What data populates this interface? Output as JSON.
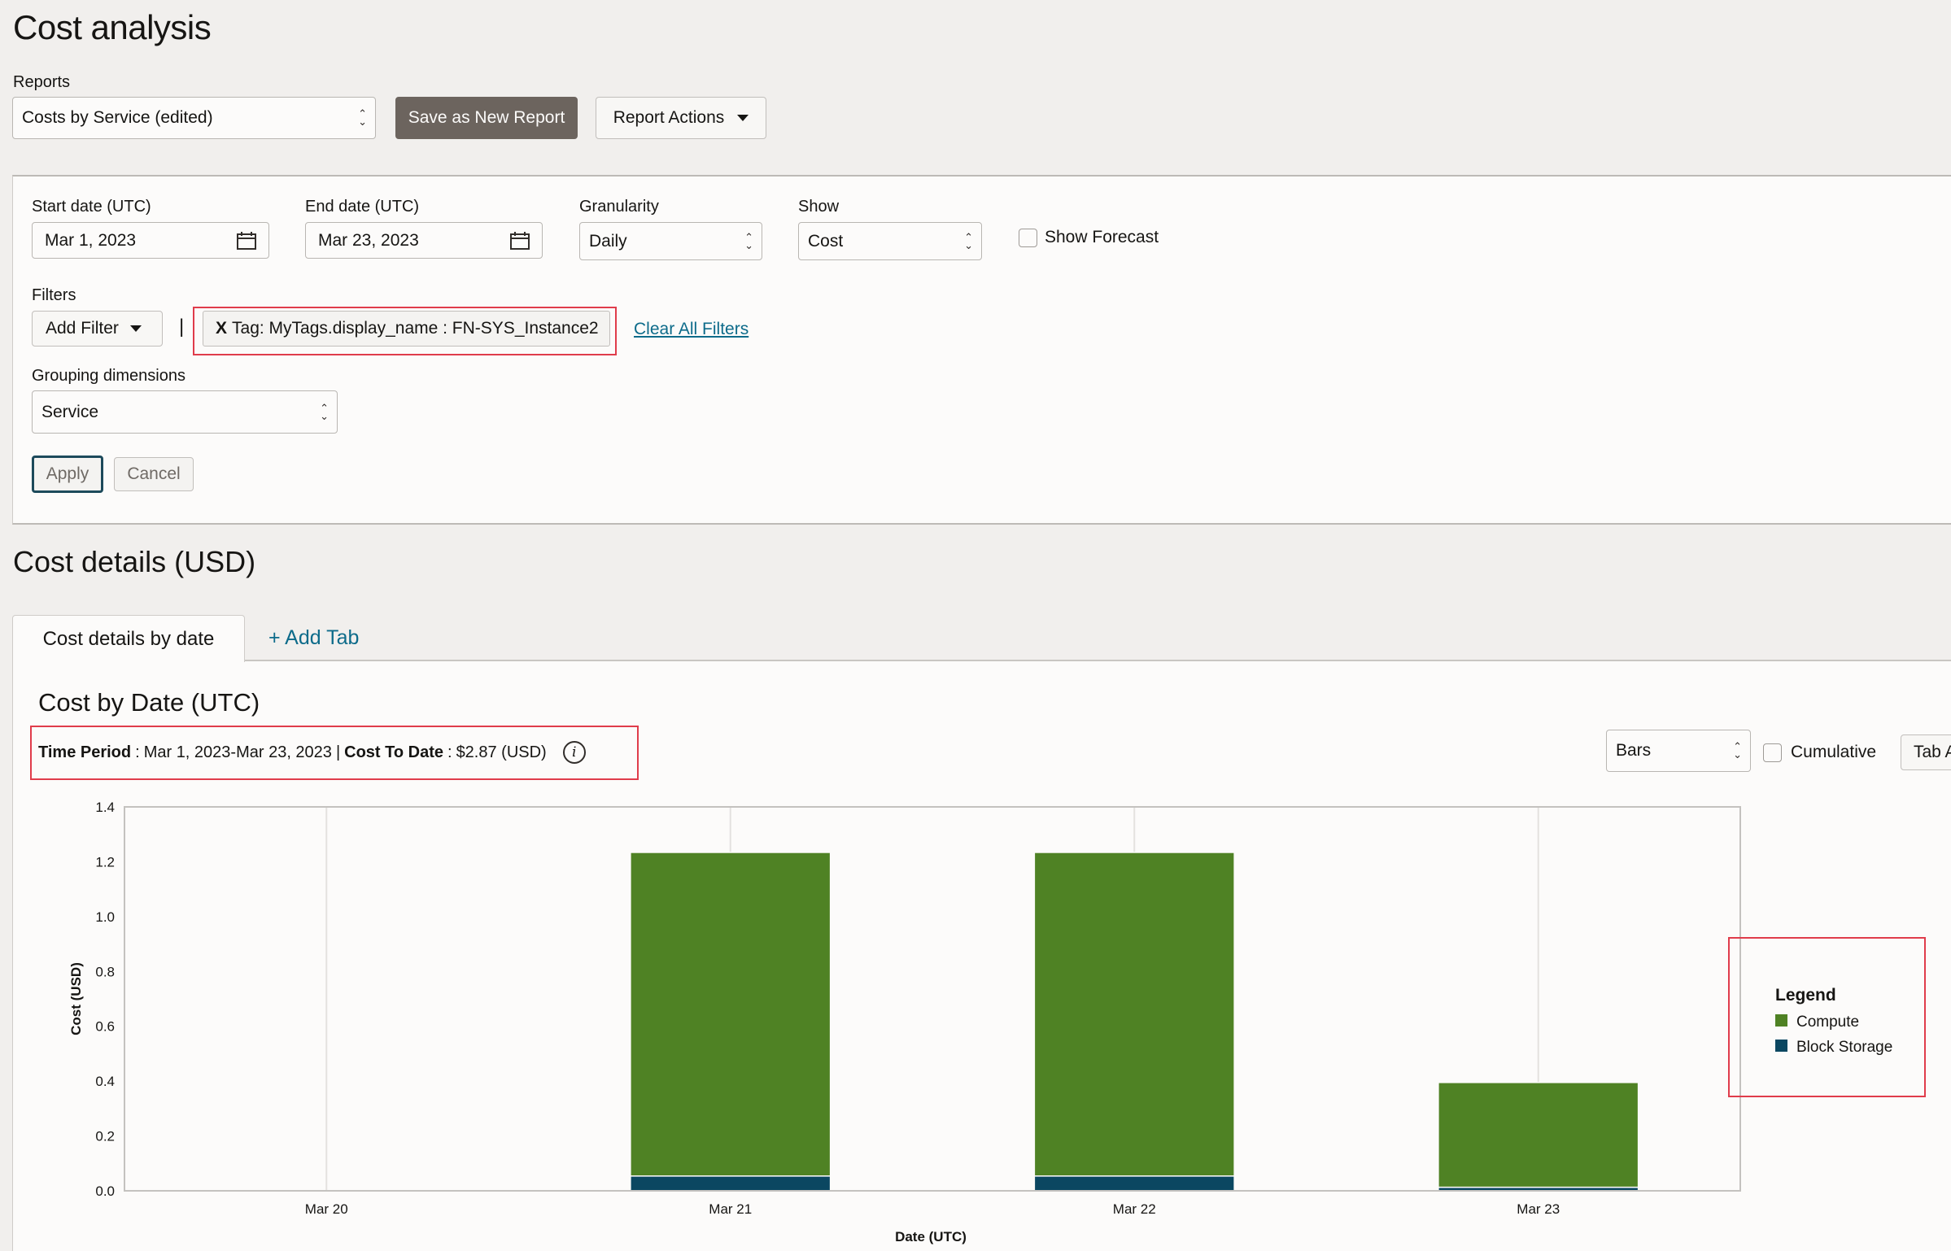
{
  "page": {
    "title": "Cost analysis"
  },
  "reports": {
    "label": "Reports",
    "selected": "Costs by Service (edited)",
    "save_button": "Save as New Report",
    "actions_button": "Report Actions"
  },
  "query": {
    "start_date": {
      "label": "Start date (UTC)",
      "value": "Mar 1, 2023"
    },
    "end_date": {
      "label": "End date (UTC)",
      "value": "Mar 23, 2023"
    },
    "granularity": {
      "label": "Granularity",
      "value": "Daily"
    },
    "show": {
      "label": "Show",
      "value": "Cost"
    },
    "show_forecast": {
      "label": "Show Forecast",
      "checked": false
    },
    "filters": {
      "label": "Filters",
      "add_filter_button": "Add Filter",
      "separator": "|",
      "active_filter_remove": "X",
      "active_filter_text": "Tag: MyTags.display_name : FN-SYS_Instance2",
      "clear_all": "Clear All Filters"
    },
    "grouping": {
      "label": "Grouping dimensions",
      "value": "Service"
    },
    "apply_button": "Apply",
    "cancel_button": "Cancel"
  },
  "details": {
    "heading": "Cost details (USD)",
    "tabs": [
      {
        "label": "Cost details by date",
        "active": true
      }
    ],
    "add_tab": "+ Add Tab",
    "chart_heading": "Cost by Date (UTC)",
    "summary": {
      "time_period_label": "Time Period",
      "time_period_value": "Mar 1, 2023-Mar 23, 2023",
      "divider": "|",
      "cost_to_date_label": "Cost To Date",
      "cost_to_date_value": "$2.87 (USD)"
    },
    "chart_type": "Bars",
    "cumulative": {
      "label": "Cumulative",
      "checked": false
    },
    "tab_actions_button": "Tab A"
  },
  "colors": {
    "compute": "#4f8224",
    "block_storage": "#0b4761",
    "highlight": "#e03c4b",
    "link": "#0d6b8a"
  },
  "chart_data": {
    "type": "bar",
    "stacked": true,
    "title": "Cost by Date (UTC)",
    "xlabel": "Date (UTC)",
    "ylabel": "Cost (USD)",
    "categories": [
      "Mar 20",
      "Mar 21",
      "Mar 22",
      "Mar 23"
    ],
    "series": [
      {
        "name": "Block Storage",
        "color": "#0b4761",
        "values": [
          0,
          0.054,
          0.054,
          0.013
        ]
      },
      {
        "name": "Compute",
        "color": "#4f8224",
        "values": [
          0,
          1.18,
          1.18,
          0.382
        ]
      }
    ],
    "ylim": [
      0,
      1.4
    ],
    "yticks": [
      "0.0",
      "0.2",
      "0.4",
      "0.6",
      "0.8",
      "1.0",
      "1.2",
      "1.4"
    ],
    "grid": "vertical",
    "legend": {
      "title": "Legend",
      "position": "right",
      "entries": [
        "Compute",
        "Block Storage"
      ]
    }
  }
}
